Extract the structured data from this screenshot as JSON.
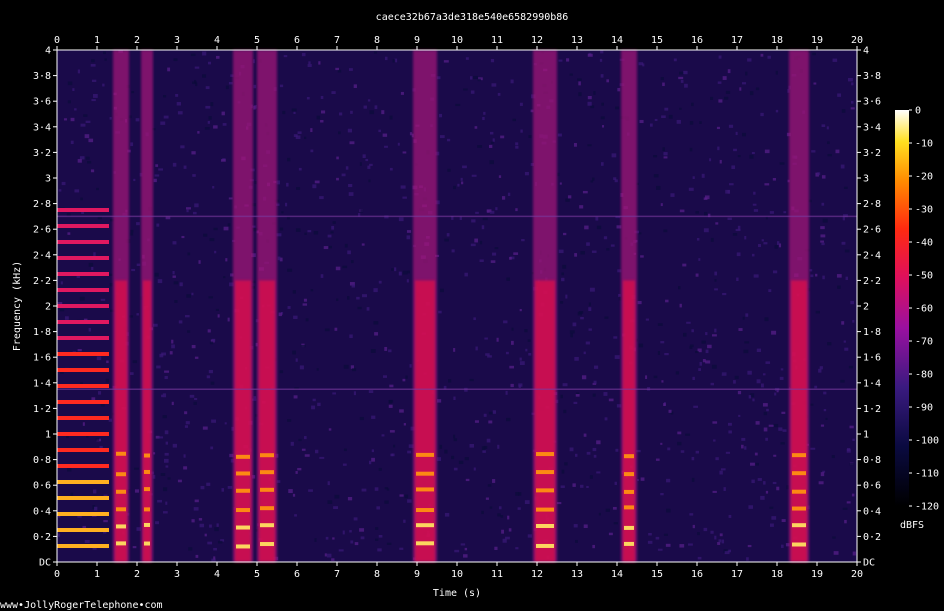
{
  "chart_data": {
    "type": "heatmap",
    "title": "caece32b67a3de318e540e6582990b86",
    "xlabel": "Time (s)",
    "ylabel": "Frequency (kHz)",
    "xlim": [
      0,
      20
    ],
    "ylim": [
      0,
      4
    ],
    "x_ticks": [
      "0",
      "1",
      "2",
      "3",
      "4",
      "5",
      "6",
      "7",
      "8",
      "9",
      "10",
      "11",
      "12",
      "13",
      "14",
      "15",
      "16",
      "17",
      "18",
      "19",
      "20"
    ],
    "y_ticks": [
      "DC",
      "0·2",
      "0·4",
      "0·6",
      "0·8",
      "1",
      "1·2",
      "1·4",
      "1·6",
      "1·8",
      "2",
      "2·2",
      "2·4",
      "2·6",
      "2·8",
      "3",
      "3·2",
      "3·4",
      "3·6",
      "3·8",
      "4"
    ],
    "colorbar": {
      "label": "dBFS",
      "ticks": [
        "0",
        "-10",
        "-20",
        "-30",
        "-40",
        "-50",
        "-60",
        "-70",
        "-80",
        "-90",
        "-100",
        "-110",
        "-120"
      ],
      "range": [
        -120,
        0
      ]
    },
    "bright_bursts_s": [
      [
        1.4,
        1.8
      ],
      [
        2.1,
        2.4
      ],
      [
        4.4,
        4.9
      ],
      [
        5.0,
        5.5
      ],
      [
        8.9,
        9.5
      ],
      [
        11.9,
        12.5
      ],
      [
        14.1,
        14.5
      ],
      [
        18.3,
        18.8
      ]
    ],
    "harmonic_tone_burst_s": [
      0.0,
      1.3
    ],
    "colors": {
      "background": "#000000",
      "low": "#000044",
      "mid": "#cc0088",
      "high": "#ff2200",
      "peak": "#ffffff"
    }
  },
  "footer": {
    "credit": "www•JollyRogerTelephone•com"
  }
}
